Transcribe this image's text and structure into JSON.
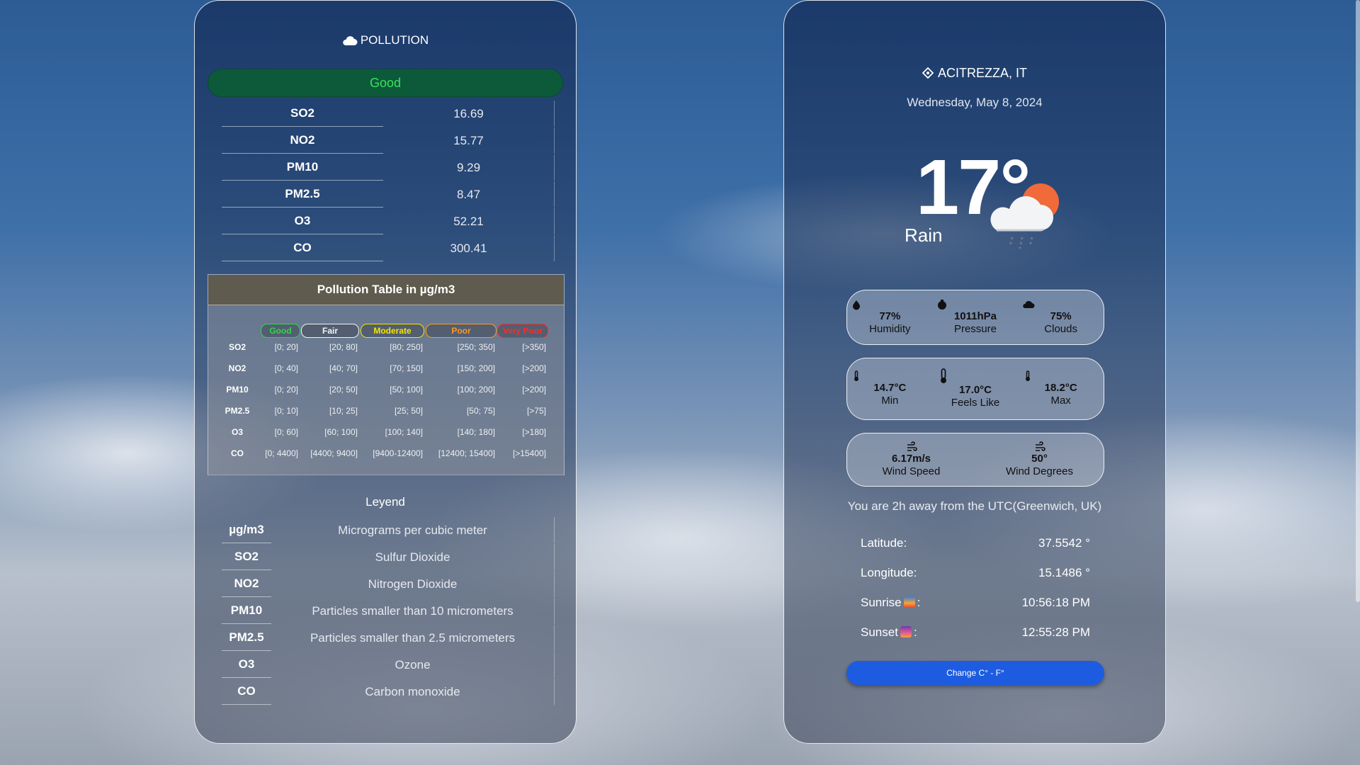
{
  "pollution": {
    "title": "POLLUTION",
    "aqi_label": "Good",
    "rows": [
      {
        "k": "SO2",
        "v": "16.69"
      },
      {
        "k": "NO2",
        "v": "15.77"
      },
      {
        "k": "PM10",
        "v": "9.29"
      },
      {
        "k": "PM2.5",
        "v": "8.47"
      },
      {
        "k": "O3",
        "v": "52.21"
      },
      {
        "k": "CO",
        "v": "300.41"
      }
    ]
  },
  "reference": {
    "title": "Pollution Table in µg/m3",
    "levels": [
      {
        "label": "Good",
        "color": "#2fd64a"
      },
      {
        "label": "Fair",
        "color": "#f3f3f3"
      },
      {
        "label": "Moderate",
        "color": "#f4e500"
      },
      {
        "label": "Poor",
        "color": "#ff9a1f"
      },
      {
        "label": "Very Poor",
        "color": "#ff2a2a"
      }
    ],
    "rows": [
      {
        "k": "SO2",
        "v": [
          "[0; 20]",
          "[20; 80]",
          "[80; 250]",
          "[250; 350]",
          "[>350]"
        ]
      },
      {
        "k": "NO2",
        "v": [
          "[0; 40]",
          "[40; 70]",
          "[70; 150]",
          "[150; 200]",
          "[>200]"
        ]
      },
      {
        "k": "PM10",
        "v": [
          "[0; 20]",
          "[20; 50]",
          "[50; 100]",
          "[100; 200]",
          "[>200]"
        ]
      },
      {
        "k": "PM2.5",
        "v": [
          "[0; 10]",
          "[10; 25]",
          "[25; 50]",
          "[50; 75]",
          "[>75]"
        ]
      },
      {
        "k": "O3",
        "v": [
          "[0; 60]",
          "[60; 100]",
          "[100; 140]",
          "[140; 180]",
          "[>180]"
        ]
      },
      {
        "k": "CO",
        "v": [
          "[0; 4400]",
          "[4400; 9400]",
          "[9400-12400]",
          "[12400; 15400]",
          "[>15400]"
        ]
      }
    ]
  },
  "legend": {
    "title": "Leyend",
    "rows": [
      {
        "k": "µg/m3",
        "v": "Micrograms per cubic meter"
      },
      {
        "k": "SO2",
        "v": "Sulfur Dioxide"
      },
      {
        "k": "NO2",
        "v": "Nitrogen Dioxide"
      },
      {
        "k": "PM10",
        "v": "Particles smaller than 10 micrometers"
      },
      {
        "k": "PM2.5",
        "v": "Particles smaller than 2.5 micrometers"
      },
      {
        "k": "O3",
        "v": "Ozone"
      },
      {
        "k": "CO",
        "v": "Carbon monoxide"
      }
    ]
  },
  "weather": {
    "location": "ACITREZZA, IT",
    "date": "Wednesday, May 8, 2024",
    "temp": "17°",
    "condition": "Rain",
    "humidity": {
      "val": "77%",
      "label": "Humidity"
    },
    "pressure": {
      "val": "1011hPa",
      "label": "Pressure"
    },
    "clouds": {
      "val": "75%",
      "label": "Clouds"
    },
    "min": {
      "val": "14.7°C",
      "label": "Min"
    },
    "feels": {
      "val": "17.0°C",
      "label": "Feels Like"
    },
    "max": {
      "val": "18.2°C",
      "label": "Max"
    },
    "wind_speed": {
      "val": "6.17m/s",
      "label": "Wind Speed"
    },
    "wind_deg": {
      "val": "50°",
      "label": "Wind Degrees"
    },
    "utc_text": "You are 2h away from the UTC(Greenwich, UK)",
    "latitude": {
      "label": "Latitude:",
      "val": "37.5542 °"
    },
    "longitude": {
      "label": "Longitude:",
      "val": "15.1486 °"
    },
    "sunrise": {
      "label_pre": "Sunrise",
      "label_post": ":",
      "val": "10:56:18 PM"
    },
    "sunset": {
      "label_pre": "Sunset",
      "label_post": ":",
      "val": "12:55:28 PM"
    },
    "toggle_label": "Change C° - F°"
  },
  "icons": {
    "cloud": "cloud-icon",
    "location": "location-pin-icon",
    "weather": "rain-cloud-sun-icon",
    "humidity": "droplet-icon",
    "pressure": "gauge-icon",
    "clouds": "cloud-icon",
    "thermometer": "thermometer-icon",
    "wind": "wind-icon",
    "sunrise": "sunrise-emoji-icon",
    "sunset": "sunset-emoji-icon"
  }
}
